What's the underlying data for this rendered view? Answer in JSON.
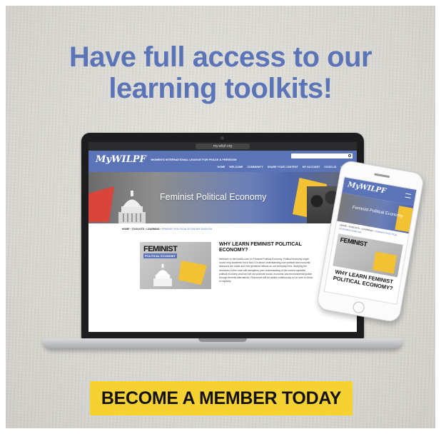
{
  "headline": {
    "line1": "Have full access to our",
    "line2": "learning toolkits!"
  },
  "laptop_site": {
    "browser_url": "my.wilpf.org",
    "logo": "MyWILPF",
    "logo_tagline": "WOMEN'S INTERNATIONAL LEAGUE FOR PEACE & FREEDOM",
    "nav": [
      "HOME",
      "WELCOME",
      "COMMUNITY",
      "SHARE YOUR CONTENT",
      "MY ACCOUNT",
      "COVID-19",
      "LOG OUT"
    ],
    "hero_title": "Feminist Political Economy",
    "breadcrumb": {
      "path": "HOME › TOOLKITS › LEARNING ›",
      "current": "FEMINIST POLITICAL ECONOMY ENGLISH"
    },
    "thumbnail": {
      "title": "FEMINIST",
      "subtitle": "POLITICAL ECONOMY"
    },
    "article_heading": "WHY LEARN FEMINIST POLITICAL ECONOMY?",
    "article_body": "Welcome to the toolkit-room on Feminist Political Economy. Political economy might sound very academic but in fact, it is about understanding how political and economic decisions are made and how gendered effects on our everyday lives. Studying the resources in this room will strengthen your understanding of the current capitalist political economy and how we can promote social, economic and environmental justice through feminist alternatives. Resources will be added continuously so be sure to check in regularly."
  },
  "phone_site": {
    "logo": "MyWILPF",
    "hero_title": "Feminist Political Economy",
    "breadcrumb": {
      "path": "HOME › TOOLKITS › LEARNING ›",
      "current": "FEMINIST POLITICAL ECONOMY ENGLISH"
    },
    "thumbnail_title": "FEMINIST",
    "heading": "WHY LEARN FEMINIST POLITICAL ECONOMY?"
  },
  "cta": {
    "label": "BECOME A MEMBER TODAY"
  },
  "colors": {
    "brand_blue": "#5b74b8",
    "cta_yellow": "#f6d132",
    "accent_red": "#d9443b"
  }
}
